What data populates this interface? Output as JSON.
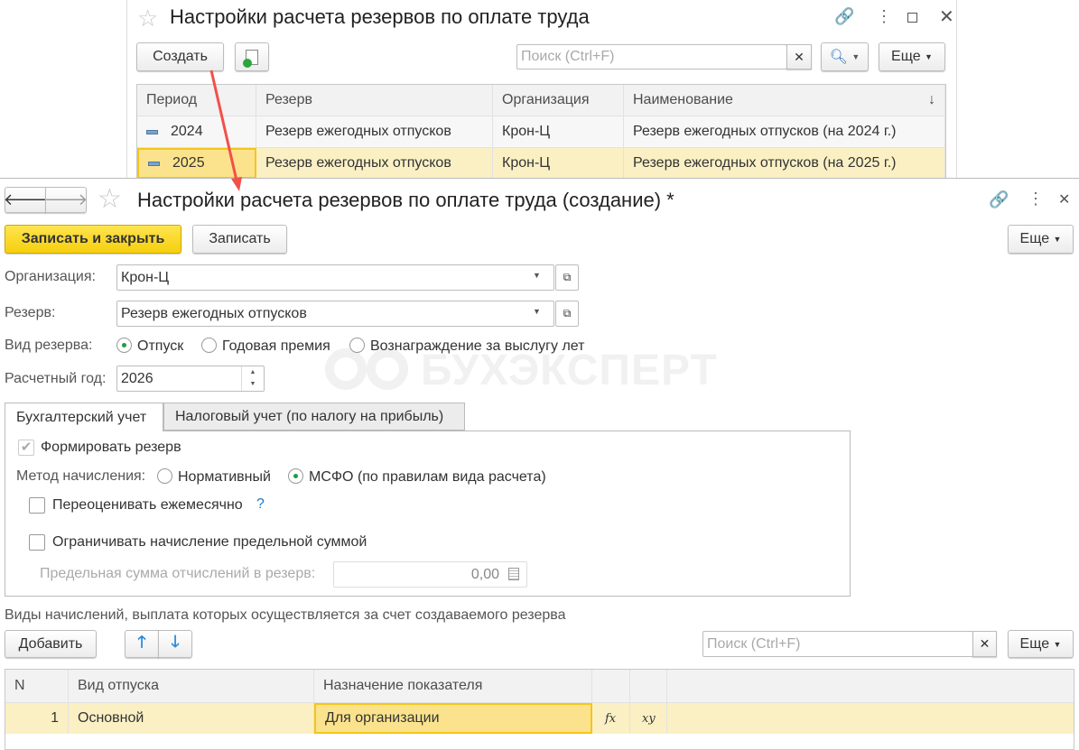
{
  "back_window": {
    "title": "Настройки расчета резервов по оплате труда",
    "create_label": "Создать",
    "search_placeholder": "Поиск (Ctrl+F)",
    "more_label": "Еще",
    "columns": [
      "Период",
      "Резерв",
      "Организация",
      "Наименование"
    ],
    "rows": [
      {
        "period": "2024",
        "reserve": "Резерв ежегодных отпусков",
        "org": "Крон-Ц",
        "name": "Резерв ежегодных отпусков (на 2024 г.)"
      },
      {
        "period": "2025",
        "reserve": "Резерв ежегодных отпусков",
        "org": "Крон-Ц",
        "name": "Резерв ежегодных отпусков (на 2025 г.)"
      }
    ]
  },
  "form": {
    "title": "Настройки расчета резервов по оплате труда (создание) *",
    "save_close_label": "Записать и закрыть",
    "save_label": "Записать",
    "more_label": "Еще",
    "org_label": "Организация:",
    "org_value": "Крон-Ц",
    "reserve_label": "Резерв:",
    "reserve_value": "Резерв ежегодных отпусков",
    "type_label": "Вид резерва:",
    "type_options": [
      "Отпуск",
      "Годовая премия",
      "Вознаграждение за выслугу лет"
    ],
    "year_label": "Расчетный год:",
    "year_value": "2026",
    "watermark": "БУХЭКСПЕРТ",
    "tabs": [
      "Бухгалтерский учет",
      "Налоговый учет (по налогу на прибыль)"
    ],
    "form_reserve_label": "Формировать резерв",
    "method_label": "Метод начисления:",
    "method_options": [
      "Нормативный",
      "МСФО (по правилам вида расчета)"
    ],
    "revalue_label": "Переоценивать ежемесячно",
    "help": "?",
    "limit_label": "Ограничивать начисление предельной суммой",
    "limit_sum_label": "Предельная сумма отчислений в резерв:",
    "limit_sum_value": "0,00",
    "section_title": "Виды начислений, выплата которых осуществляется за счет создаваемого резерва",
    "add_label": "Добавить",
    "search_placeholder": "Поиск (Ctrl+F)",
    "more2_label": "Еще",
    "columns": [
      "N",
      "Вид отпуска",
      "Назначение показателя"
    ],
    "rows": [
      {
        "n": "1",
        "kind": "Основной",
        "purpose": "Для организации",
        "fx": "fx",
        "xy": "xy"
      }
    ]
  }
}
